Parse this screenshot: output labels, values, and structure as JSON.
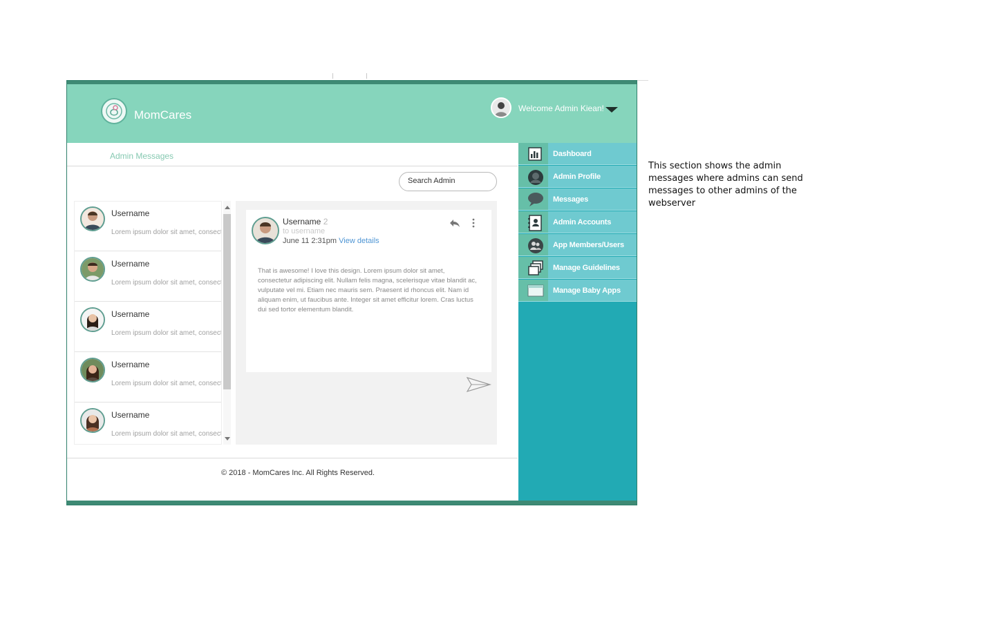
{
  "app": {
    "brand": "MomCares",
    "welcome": "Welcome Admin Kiean!"
  },
  "page": {
    "title": "Admin Messages",
    "search_placeholder": "Search Admin"
  },
  "conversations": [
    {
      "name": "Username",
      "preview": "Lorem ipsum dolor sit amet, consectetur"
    },
    {
      "name": "Username",
      "preview": "Lorem ipsum dolor sit amet, consectetur"
    },
    {
      "name": "Username",
      "preview": "Lorem ipsum dolor sit amet, consectetur"
    },
    {
      "name": "Username",
      "preview": "Lorem ipsum dolor sit amet, consectetur"
    },
    {
      "name": "Username",
      "preview": "Lorem ipsum dolor sit amet, consectetur"
    }
  ],
  "message": {
    "sender": "Username",
    "count": "2",
    "to": "to username",
    "date": "June 11 2:31pm",
    "link": "View details",
    "body": "That is awesome! I love this design. Lorem ipsum dolor sit amet, consectetur adipiscing elit. Nullam felis magna, scelerisque vitae blandit ac, vulputate vel mi. Etiam nec mauris sem. Praesent id rhoncus elit. Nam id aliquam enim, ut faucibus ante. Integer sit amet efficitur lorem. Cras luctus dui sed tortor elementum blandit."
  },
  "sidebar": {
    "items": [
      {
        "label": "Dashboard",
        "icon": "chart-icon"
      },
      {
        "label": "Admin Profile",
        "icon": "profile-icon"
      },
      {
        "label": "Messages",
        "icon": "chat-bubble-icon"
      },
      {
        "label": "Admin Accounts",
        "icon": "contacts-icon"
      },
      {
        "label": "App Members/Users",
        "icon": "group-icon"
      },
      {
        "label": "Manage Guidelines",
        "icon": "pages-icon"
      },
      {
        "label": "Manage Baby Apps",
        "icon": "window-icon"
      }
    ]
  },
  "footer": {
    "text": "© 2018 - MomCares Inc. All Rights Reserved."
  },
  "note": {
    "text": "This section shows the admin messages where admins can send messages to other admins of the webserver"
  },
  "colors": {
    "header": "#86d5bc",
    "sidebar": "#22aab4",
    "sidebar_item": "#6fcad0",
    "accent": "#3e8a74"
  }
}
